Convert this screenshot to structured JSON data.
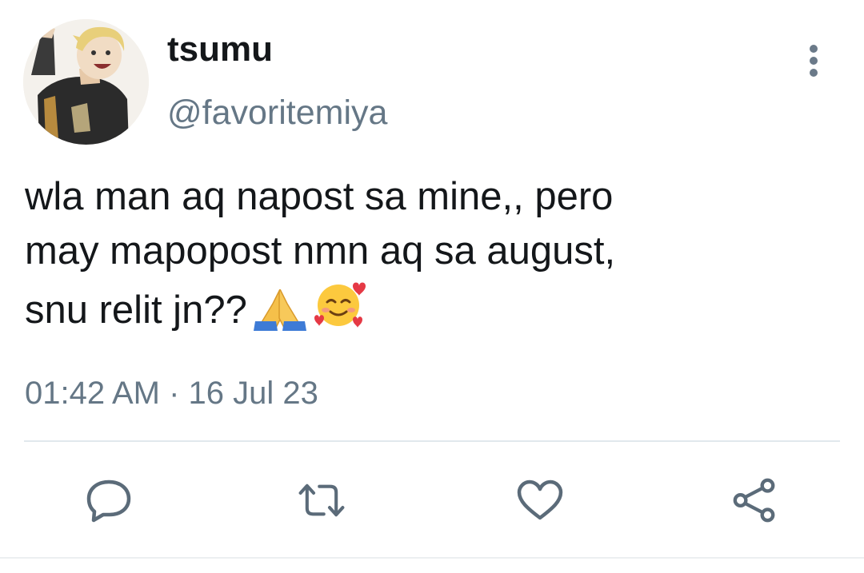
{
  "user": {
    "display_name": "tsumu",
    "handle": "@favoritemiya"
  },
  "tweet": {
    "lines": [
      "wla man aq napost sa mine,, pero",
      "may mapopost nmn aq sa august,",
      "snu relit jn??"
    ],
    "emojis": [
      "folded-hands-icon",
      "smiling-face-with-hearts-icon"
    ],
    "timestamp": "01:42 AM · 16 Jul 23"
  },
  "actions": [
    "reply-icon",
    "retweet-icon",
    "like-icon",
    "share-icon"
  ],
  "colors": {
    "text": "#14171a",
    "secondary": "#657786",
    "icon": "#5b6b79",
    "divider": "#e1e8ed"
  }
}
